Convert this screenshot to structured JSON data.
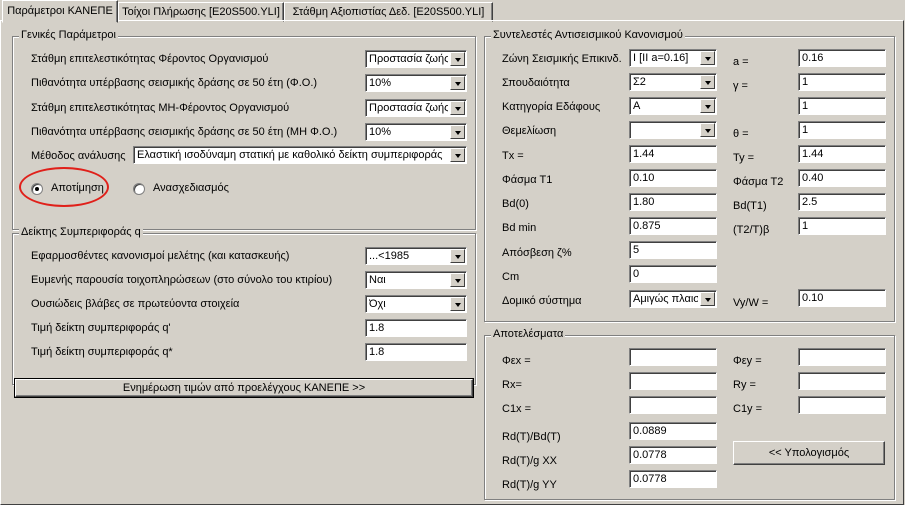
{
  "tabs": [
    "Παράμετροι ΚΑΝΕΠΕ",
    "Τοίχοι Πλήρωσης [E20S500.YLI]",
    "Στάθμη Αξιοπιστίας Δεδ. [E20S500.YLI]"
  ],
  "general": {
    "title": "Γενικές Παράμετροι",
    "rows": [
      {
        "label": "Στάθμη επιτελεστικότητας Φέροντος Οργανισμού",
        "value": "Προστασία ζωής"
      },
      {
        "label": "Πιθανότητα υπέρβασης σεισμικής δράσης σε 50 έτη (Φ.Ο.)",
        "value": "10%"
      },
      {
        "label": "Στάθμη επιτελεστικότητας ΜΗ-Φέροντος Οργανισμού",
        "value": "Προστασία ζωής"
      },
      {
        "label": "Πιθανότητα υπέρβασης σεισμικής δράσης σε 50 έτη (ΜΗ Φ.Ο.)",
        "value": "10%"
      }
    ],
    "method_label": "Μέθοδος ανάλυσης",
    "method_value": "Ελαστική ισοδύναμη στατική με καθολικό δείκτη συμπεριφοράς",
    "radio_assess": "Αποτίμηση",
    "radio_redesign": "Ανασχεδιασμός"
  },
  "behavior": {
    "title": "Δείκτης Συμπεριφοράς q",
    "rows": [
      {
        "label": "Εφαρμοσθέντες κανονισμοί μελέτης (και κατασκευής)",
        "value": "...<1985",
        "type": "combo"
      },
      {
        "label": "Ευμενής παρουσία τοιχοπληρώσεων (στο σύνολο του κτιρίου)",
        "value": "Ναι",
        "type": "combo"
      },
      {
        "label": "Ουσιώδεις βλάβες σε πρωτεύοντα στοιχεία",
        "value": "Όχι",
        "type": "combo"
      },
      {
        "label": "Τιμή δείκτη συμπεριφοράς q'",
        "value": "1.8",
        "type": "edit"
      },
      {
        "label": "Τιμή δείκτη συμπεριφοράς q*",
        "value": "1.8",
        "type": "edit"
      }
    ],
    "update_button": "Ενημέρωση τιμών από προελέγχους ΚΑΝΕΠΕ >>"
  },
  "seismic": {
    "title": "Συντελεστές Αντισεισμικού Κανονισμού",
    "left": [
      {
        "label": "Ζώνη Σεισμικής Επικινδ.",
        "value": "I [II a=0.16]",
        "type": "combo"
      },
      {
        "label": "Σπουδαιότητα",
        "value": "Σ2",
        "type": "combo"
      },
      {
        "label": "Κατηγορία Εδάφους",
        "value": "A",
        "type": "combo"
      },
      {
        "label": "Θεμελίωση",
        "value": "",
        "type": "combo"
      },
      {
        "label": "Tx =",
        "value": "1.44",
        "type": "edit"
      },
      {
        "label": "Φάσμα Τ1",
        "value": "0.10",
        "type": "edit"
      },
      {
        "label": "Bd(0)",
        "value": "1.80",
        "type": "edit"
      },
      {
        "label": "Bd min",
        "value": "0.875",
        "type": "edit"
      },
      {
        "label": "Απόσβεση ζ%",
        "value": "5",
        "type": "edit"
      },
      {
        "label": "Cm",
        "value": "0",
        "type": "edit"
      },
      {
        "label": "Δομικό σύστημα",
        "value": "Αμιγώς πλαισ",
        "type": "combo"
      }
    ],
    "right": [
      {
        "label": "a =",
        "value": "0.16"
      },
      {
        "label": "γ =",
        "value": "1"
      },
      {
        "label": "",
        "value": "1"
      },
      {
        "label": "θ =",
        "value": "1"
      },
      {
        "label": "Ty =",
        "value": "1.44"
      },
      {
        "label": "Φάσμα Τ2",
        "value": "0.40"
      },
      {
        "label": "Bd(T1)",
        "value": "2.5"
      },
      {
        "label": "(T2/T)β",
        "value": "1"
      }
    ],
    "vyw_label": "Vy/W =",
    "vyw_value": "0.10"
  },
  "results": {
    "title": "Αποτελέσματα",
    "left": [
      {
        "label": "Φεx =",
        "value": ""
      },
      {
        "label": "Rx=",
        "value": ""
      },
      {
        "label": "C1x =",
        "value": ""
      },
      {
        "label": "Rd(T)/Bd(T)",
        "value": "0.0889"
      },
      {
        "label": "Rd(T)/g XX",
        "value": "0.0778"
      },
      {
        "label": "Rd(T)/g YY",
        "value": "0.0778"
      }
    ],
    "right": [
      {
        "label": "Φεy =",
        "value": ""
      },
      {
        "label": "Ry =",
        "value": ""
      },
      {
        "label": "C1y =",
        "value": ""
      }
    ],
    "calc_button": "<< Υπολογισμός"
  },
  "highlight_color": "#e0201a"
}
